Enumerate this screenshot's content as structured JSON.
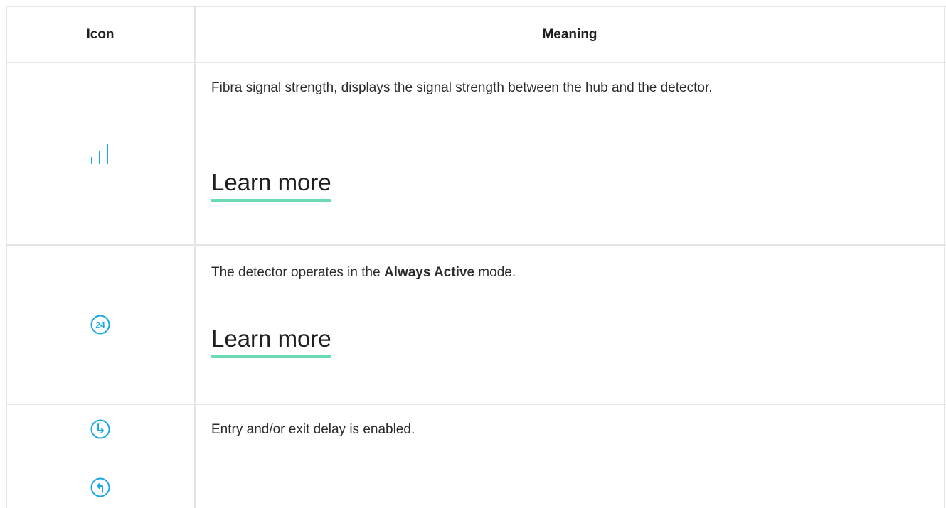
{
  "header": {
    "icon_col": "Icon",
    "meaning_col": "Meaning"
  },
  "rows": [
    {
      "icon": "signal-strength-icon",
      "text": "Fibra signal strength, displays the signal strength between the hub and the detector.",
      "link": "Learn more"
    },
    {
      "icon": "always-active-24-icon",
      "icon_text": "24",
      "text_before": "The detector operates in the ",
      "text_bold": "Always Active",
      "text_after": " mode.",
      "link": "Learn more"
    },
    {
      "icons": [
        "entry-delay-icon",
        "exit-delay-icon"
      ],
      "text": "Entry and/or exit delay is enabled."
    }
  ],
  "colors": {
    "icon": "#1aa8e8",
    "underline": "#6bd9b1",
    "border": "#e5e5e5"
  }
}
